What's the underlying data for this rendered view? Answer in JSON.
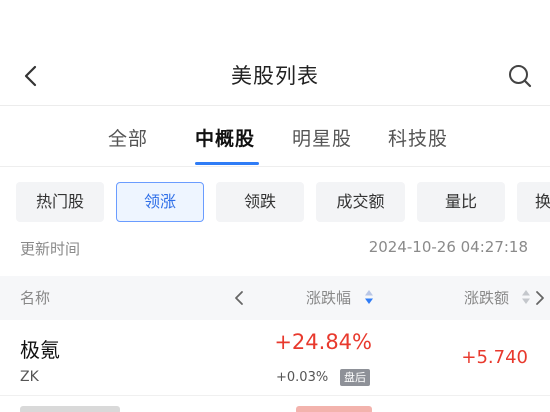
{
  "header": {
    "title": "美股列表",
    "back_icon": "chevron-left-icon",
    "search_icon": "search-icon"
  },
  "tabs": [
    {
      "label": "全部",
      "active": false
    },
    {
      "label": "中概股",
      "active": true
    },
    {
      "label": "明星股",
      "active": false
    },
    {
      "label": "科技股",
      "active": false
    }
  ],
  "chips": [
    {
      "label": "热门股",
      "active": false
    },
    {
      "label": "领涨",
      "active": true
    },
    {
      "label": "领跌",
      "active": false
    },
    {
      "label": "成交额",
      "active": false
    },
    {
      "label": "量比",
      "active": false
    },
    {
      "label": "换",
      "active": false
    }
  ],
  "update": {
    "label": "更新时间",
    "time": "2024-10-26 04:27:18"
  },
  "columns": {
    "name": "名称",
    "change_pct": "涨跌幅",
    "change_amt": "涨跌额"
  },
  "rows": [
    {
      "name": "极氪",
      "code": "ZK",
      "change_pct": "+24.84%",
      "after_hours_pct": "+0.03%",
      "after_hours_badge": "盘后",
      "change_amt": "+5.740"
    }
  ],
  "colors": {
    "up": "#e8392d",
    "accent": "#2f7cf6",
    "muted": "#8a8a8a"
  }
}
